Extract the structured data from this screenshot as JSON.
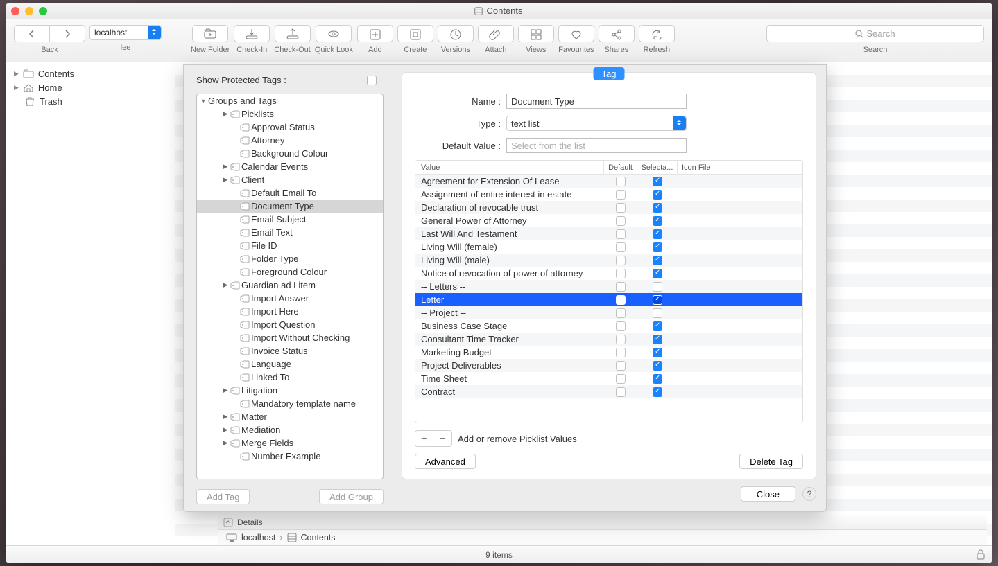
{
  "window": {
    "title": "Contents"
  },
  "toolbar": {
    "back_label": "Back",
    "user_label": "lee",
    "host": "localhost",
    "buttons": [
      {
        "icon": "folder-plus",
        "label": "New Folder"
      },
      {
        "icon": "download",
        "label": "Check-In"
      },
      {
        "icon": "upload",
        "label": "Check-Out"
      },
      {
        "icon": "eye",
        "label": "Quick Look"
      },
      {
        "icon": "plus",
        "label": "Add"
      },
      {
        "icon": "expand",
        "label": "Create"
      },
      {
        "icon": "clock",
        "label": "Versions"
      },
      {
        "icon": "paperclip",
        "label": "Attach"
      },
      {
        "icon": "views",
        "label": "Views"
      },
      {
        "icon": "heart",
        "label": "Favourites"
      },
      {
        "icon": "shares",
        "label": "Shares"
      },
      {
        "icon": "refresh",
        "label": "Refresh"
      }
    ],
    "search_placeholder": "Search",
    "search_label": "Search"
  },
  "sidebar": [
    {
      "icon": "folder",
      "label": "Contents",
      "arrow": true
    },
    {
      "icon": "home",
      "label": "Home",
      "arrow": true
    },
    {
      "icon": "trash",
      "label": "Trash",
      "arrow": false
    }
  ],
  "sheet": {
    "protected_label": "Show Protected Tags :",
    "tree_root": "Groups and Tags",
    "tree": [
      {
        "label": "Picklists",
        "indent": 1,
        "arrow": true,
        "icon": "tag"
      },
      {
        "label": "Approval Status",
        "indent": 2,
        "icon": "tag"
      },
      {
        "label": "Attorney",
        "indent": 2,
        "icon": "tag"
      },
      {
        "label": "Background Colour",
        "indent": 2,
        "icon": "tag"
      },
      {
        "label": "Calendar Events",
        "indent": 1,
        "arrow": true,
        "icon": "tag"
      },
      {
        "label": "Client",
        "indent": 1,
        "arrow": true,
        "icon": "tag"
      },
      {
        "label": "Default Email To",
        "indent": 2,
        "icon": "tag"
      },
      {
        "label": "Document Type",
        "indent": 2,
        "icon": "tag",
        "selected": true
      },
      {
        "label": "Email Subject",
        "indent": 2,
        "icon": "tag"
      },
      {
        "label": "Email Text",
        "indent": 2,
        "icon": "tag"
      },
      {
        "label": "File ID",
        "indent": 2,
        "icon": "tag"
      },
      {
        "label": "Folder Type",
        "indent": 2,
        "icon": "tag"
      },
      {
        "label": "Foreground Colour",
        "indent": 2,
        "icon": "tag"
      },
      {
        "label": "Guardian ad Litem",
        "indent": 1,
        "arrow": true,
        "icon": "tag"
      },
      {
        "label": "Import Answer",
        "indent": 2,
        "icon": "tag"
      },
      {
        "label": "Import Here",
        "indent": 2,
        "icon": "tag"
      },
      {
        "label": "Import Question",
        "indent": 2,
        "icon": "tag"
      },
      {
        "label": "Import Without Checking",
        "indent": 2,
        "icon": "tag"
      },
      {
        "label": "Invoice Status",
        "indent": 2,
        "icon": "tag"
      },
      {
        "label": "Language",
        "indent": 2,
        "icon": "tag"
      },
      {
        "label": "Linked To",
        "indent": 2,
        "icon": "tag"
      },
      {
        "label": "Litigation",
        "indent": 1,
        "arrow": true,
        "icon": "tag"
      },
      {
        "label": "Mandatory template name",
        "indent": 2,
        "icon": "tag"
      },
      {
        "label": "Matter",
        "indent": 1,
        "arrow": true,
        "icon": "tag"
      },
      {
        "label": "Mediation",
        "indent": 1,
        "arrow": true,
        "icon": "tag"
      },
      {
        "label": "Merge Fields",
        "indent": 1,
        "arrow": true,
        "icon": "tag"
      },
      {
        "label": "Number Example",
        "indent": 2,
        "icon": "tag"
      }
    ],
    "add_tag_label": "Add Tag",
    "add_group_label": "Add Group",
    "tag_pill": "Tag",
    "name_label": "Name :",
    "name_value": "Document Type",
    "type_label": "Type :",
    "type_value": "text list",
    "default_label": "Default Value :",
    "default_placeholder": "Select from the list",
    "table_headers": {
      "value": "Value",
      "default": "Default",
      "selectable": "Selecta...",
      "icon": "Icon File"
    },
    "table_rows": [
      {
        "value": "Agreement for Extension Of Lease",
        "default": false,
        "selectable": true
      },
      {
        "value": "Assignment of entire interest in estate",
        "default": false,
        "selectable": true
      },
      {
        "value": "Declaration of revocable trust",
        "default": false,
        "selectable": true
      },
      {
        "value": "General Power of Attorney",
        "default": false,
        "selectable": true
      },
      {
        "value": "Last Will And Testament",
        "default": false,
        "selectable": true
      },
      {
        "value": "Living Will (female)",
        "default": false,
        "selectable": true
      },
      {
        "value": "Living Will (male)",
        "default": false,
        "selectable": true
      },
      {
        "value": "Notice of revocation of power of attorney",
        "default": false,
        "selectable": true
      },
      {
        "value": "-- Letters --",
        "default": false,
        "selectable": false
      },
      {
        "value": "Letter",
        "default": false,
        "selectable": true,
        "selected": true
      },
      {
        "value": "-- Project --",
        "default": false,
        "selectable": false
      },
      {
        "value": "Business Case Stage",
        "default": false,
        "selectable": true
      },
      {
        "value": "Consultant Time Tracker",
        "default": false,
        "selectable": true
      },
      {
        "value": "Marketing Budget",
        "default": false,
        "selectable": true
      },
      {
        "value": "Project Deliverables",
        "default": false,
        "selectable": true
      },
      {
        "value": "Time Sheet",
        "default": false,
        "selectable": true
      },
      {
        "value": "Contract",
        "default": false,
        "selectable": true
      }
    ],
    "picklist_hint": "Add or remove Picklist Values",
    "advanced_label": "Advanced",
    "delete_label": "Delete Tag",
    "close_label": "Close"
  },
  "details": {
    "toggle_label": "Details"
  },
  "breadcrumb": {
    "host": "localhost",
    "current": "Contents"
  },
  "statusbar": {
    "text": "9 items"
  }
}
